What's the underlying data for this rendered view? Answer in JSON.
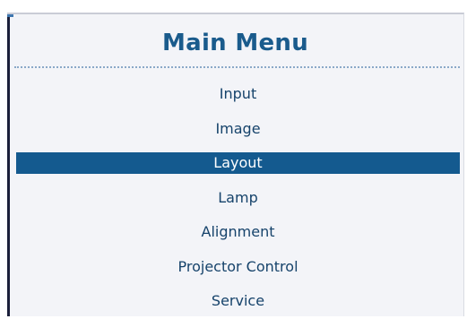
{
  "menu": {
    "title": "Main Menu",
    "items": [
      {
        "label": "Input",
        "selected": false
      },
      {
        "label": "Image",
        "selected": false
      },
      {
        "label": "Layout",
        "selected": true
      },
      {
        "label": "Lamp",
        "selected": false
      },
      {
        "label": "Alignment",
        "selected": false
      },
      {
        "label": "Projector Control",
        "selected": false
      },
      {
        "label": "Service",
        "selected": false
      }
    ]
  },
  "colors": {
    "title": "#1a5b8c",
    "item_text": "#16436b",
    "selection_bg": "#145a8f",
    "selection_text": "#ffffff",
    "panel_bg": "#f3f4f8"
  }
}
